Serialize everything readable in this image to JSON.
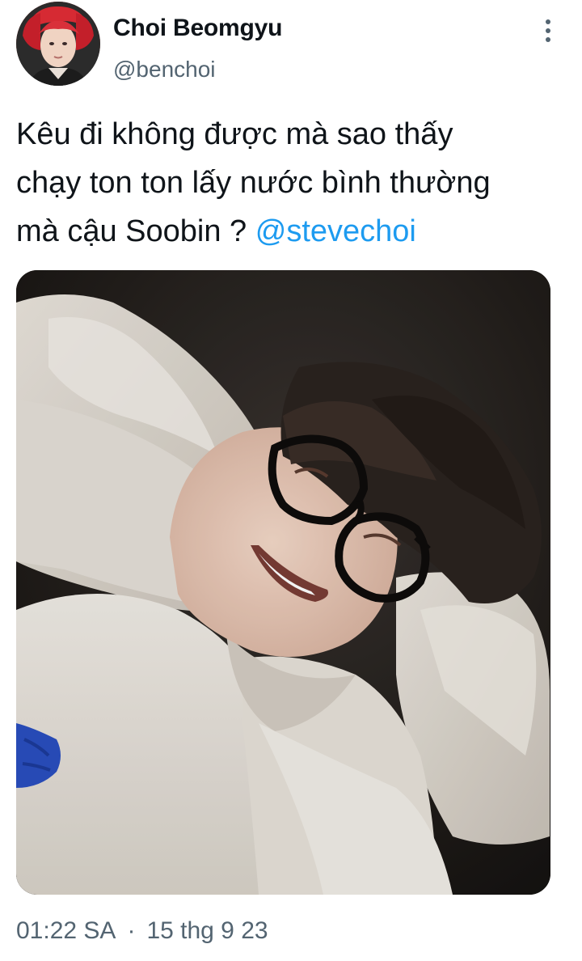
{
  "tweet": {
    "author": {
      "display_name": "Choi Beomgyu",
      "handle": "@benchoi",
      "avatar_icon": "profile-photo"
    },
    "more_icon": "vertical-ellipsis-icon",
    "text_lines": [
      "Kêu đi không được mà sao thấy",
      "chạy ton ton lấy nước bình thường",
      "mà cậu Soobin ? "
    ],
    "mention": "@stevechoi",
    "media": {
      "kind": "photo"
    },
    "time": "01:22 SA",
    "separator": "·",
    "date": "15 thg 9 23"
  },
  "colors": {
    "text": "#0f1419",
    "secondary": "#536471",
    "link": "#1d9bf0",
    "background": "#ffffff"
  }
}
